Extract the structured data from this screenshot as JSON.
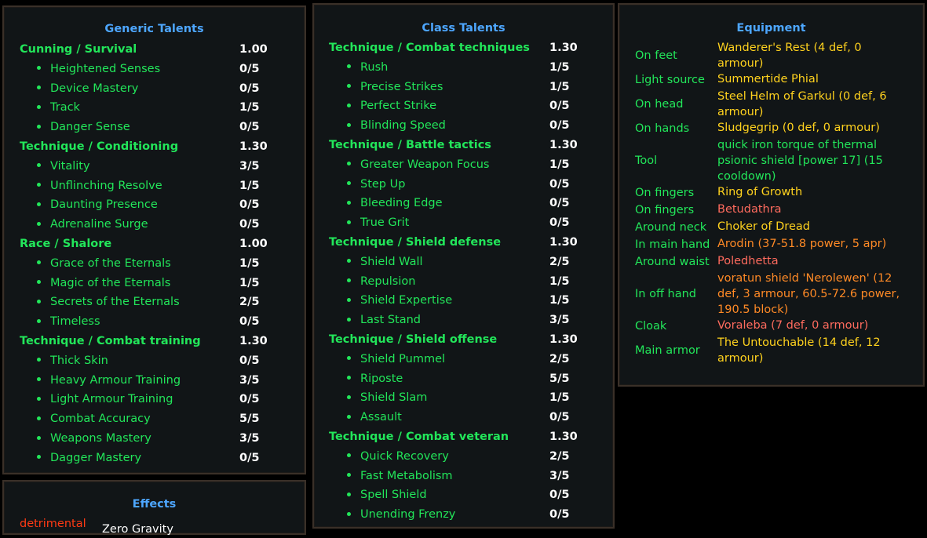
{
  "generic": {
    "title": "Generic Talents",
    "groups": [
      {
        "name": "Cunning / Survival",
        "mult": "1.00",
        "talents": [
          {
            "name": "Heightened Senses",
            "rank": "0/5"
          },
          {
            "name": "Device Mastery",
            "rank": "0/5"
          },
          {
            "name": "Track",
            "rank": "1/5"
          },
          {
            "name": "Danger Sense",
            "rank": "0/5"
          }
        ]
      },
      {
        "name": "Technique / Conditioning",
        "mult": "1.30",
        "talents": [
          {
            "name": "Vitality",
            "rank": "3/5"
          },
          {
            "name": "Unflinching Resolve",
            "rank": "1/5"
          },
          {
            "name": "Daunting Presence",
            "rank": "0/5"
          },
          {
            "name": "Adrenaline Surge",
            "rank": "0/5"
          }
        ]
      },
      {
        "name": "Race / Shalore",
        "mult": "1.00",
        "talents": [
          {
            "name": "Grace of the Eternals",
            "rank": "1/5"
          },
          {
            "name": "Magic of the Eternals",
            "rank": "1/5"
          },
          {
            "name": "Secrets of the Eternals",
            "rank": "2/5"
          },
          {
            "name": "Timeless",
            "rank": "0/5"
          }
        ]
      },
      {
        "name": "Technique / Combat training",
        "mult": "1.30",
        "talents": [
          {
            "name": "Thick Skin",
            "rank": "0/5"
          },
          {
            "name": "Heavy Armour Training",
            "rank": "3/5"
          },
          {
            "name": "Light Armour Training",
            "rank": "0/5"
          },
          {
            "name": "Combat Accuracy",
            "rank": "5/5"
          },
          {
            "name": "Weapons Mastery",
            "rank": "3/5"
          },
          {
            "name": "Dagger Mastery",
            "rank": "0/5"
          }
        ]
      }
    ]
  },
  "class": {
    "title": "Class Talents",
    "groups": [
      {
        "name": "Technique / Combat techniques",
        "mult": "1.30",
        "talents": [
          {
            "name": "Rush",
            "rank": "1/5"
          },
          {
            "name": "Precise Strikes",
            "rank": "1/5"
          },
          {
            "name": "Perfect Strike",
            "rank": "0/5"
          },
          {
            "name": "Blinding Speed",
            "rank": "0/5"
          }
        ]
      },
      {
        "name": "Technique / Battle tactics",
        "mult": "1.30",
        "talents": [
          {
            "name": "Greater Weapon Focus",
            "rank": "1/5"
          },
          {
            "name": "Step Up",
            "rank": "0/5"
          },
          {
            "name": "Bleeding Edge",
            "rank": "0/5"
          },
          {
            "name": "True Grit",
            "rank": "0/5"
          }
        ]
      },
      {
        "name": "Technique / Shield defense",
        "mult": "1.30",
        "talents": [
          {
            "name": "Shield Wall",
            "rank": "2/5"
          },
          {
            "name": "Repulsion",
            "rank": "1/5"
          },
          {
            "name": "Shield Expertise",
            "rank": "1/5"
          },
          {
            "name": "Last Stand",
            "rank": "3/5"
          }
        ]
      },
      {
        "name": "Technique / Shield offense",
        "mult": "1.30",
        "talents": [
          {
            "name": "Shield Pummel",
            "rank": "2/5"
          },
          {
            "name": "Riposte",
            "rank": "5/5"
          },
          {
            "name": "Shield Slam",
            "rank": "1/5"
          },
          {
            "name": "Assault",
            "rank": "0/5"
          }
        ]
      },
      {
        "name": "Technique / Combat veteran",
        "mult": "1.30",
        "talents": [
          {
            "name": "Quick Recovery",
            "rank": "2/5"
          },
          {
            "name": "Fast Metabolism",
            "rank": "3/5"
          },
          {
            "name": "Spell Shield",
            "rank": "0/5"
          },
          {
            "name": "Unending Frenzy",
            "rank": "0/5"
          }
        ]
      }
    ]
  },
  "equipment": {
    "title": "Equipment",
    "slots": [
      {
        "slot": "On feet",
        "lines": [
          "Wanderer's Rest (4 def, 0",
          "armour)"
        ],
        "color": "#ffd21e"
      },
      {
        "slot": "Light source",
        "lines": [
          "Summertide Phial"
        ],
        "color": "#ffd21e"
      },
      {
        "slot": "On head",
        "lines": [
          "Steel Helm of Garkul (0 def, 6",
          "armour)"
        ],
        "color": "#ffd21e"
      },
      {
        "slot": "On hands",
        "lines": [
          "Sludgegrip (0 def, 0 armour)"
        ],
        "color": "#ffd21e"
      },
      {
        "slot": "Tool",
        "lines": [
          "quick iron torque of thermal",
          "psionic shield [power 17] (15",
          "cooldown)"
        ],
        "color": "#22e65a"
      },
      {
        "slot": "On fingers",
        "lines": [
          "Ring of Growth"
        ],
        "color": "#ffd21e"
      },
      {
        "slot": "On fingers",
        "lines": [
          "Betudathra"
        ],
        "color": "#ff6b5e"
      },
      {
        "slot": "Around neck",
        "lines": [
          "Choker of Dread"
        ],
        "color": "#ffd21e"
      },
      {
        "slot": "In main hand",
        "lines": [
          "Arodin (37-51.8 power, 5 apr)"
        ],
        "color": "#ff8a26"
      },
      {
        "slot": "Around waist",
        "lines": [
          "Poledhetta"
        ],
        "color": "#ff6b5e"
      },
      {
        "slot": "In off hand",
        "lines": [
          "voratun shield 'Nerolewen' (12",
          "def, 3 armour, 60.5-72.6 power,",
          "190.5 block)"
        ],
        "color": "#ff8a26"
      },
      {
        "slot": "Cloak",
        "lines": [
          "Voraleba (7 def, 0 armour)"
        ],
        "color": "#ff6b5e"
      },
      {
        "slot": "Main armor",
        "lines": [
          "The Untouchable (14 def, 12",
          "armour)"
        ],
        "color": "#ffd21e"
      }
    ]
  },
  "effects": {
    "title": "Effects",
    "items": [
      {
        "type": "detrimental",
        "name": "Zero Gravity"
      }
    ]
  }
}
